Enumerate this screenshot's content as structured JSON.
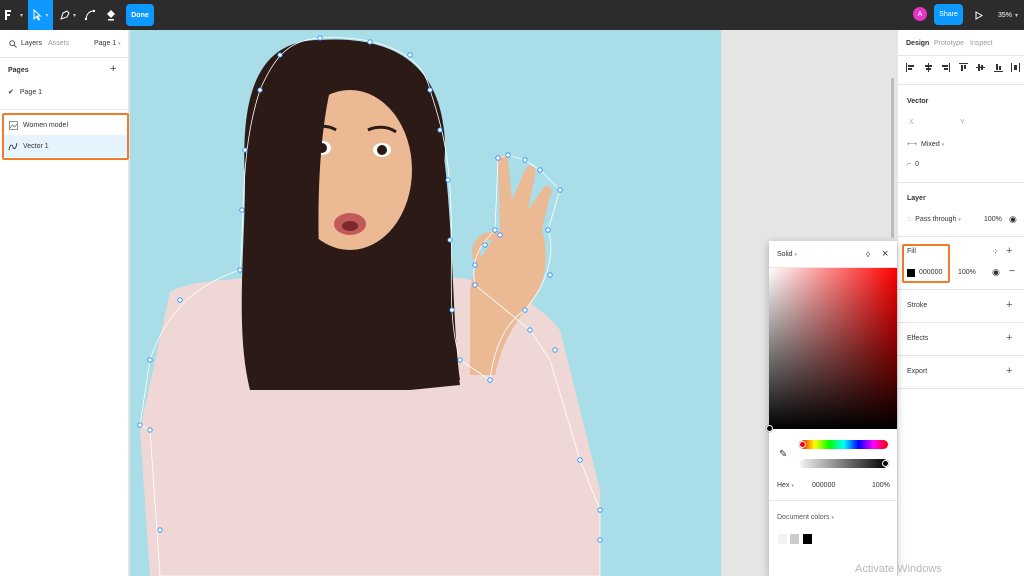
{
  "toolbar": {
    "done_label": "Done",
    "avatar_initial": "A",
    "share_label": "Share",
    "zoom": "35%"
  },
  "left_panel": {
    "tab_layers": "Layers",
    "tab_assets": "Assets",
    "page_selector": "Page 1",
    "pages_heading": "Pages",
    "pages": [
      {
        "label": "Page 1",
        "current": true
      }
    ],
    "layers": [
      {
        "label": "Women model",
        "icon": "image-icon",
        "selected": false
      },
      {
        "label": "Vector 1",
        "icon": "vector-path-icon",
        "selected": true
      }
    ]
  },
  "right_panel": {
    "tabs": [
      "Design",
      "Prototype",
      "Inspect"
    ],
    "active_tab": "Design",
    "vector_heading": "Vector",
    "x_label": "X",
    "y_label": "Y",
    "corner_value": "Mixed",
    "rotation_value": "0",
    "layer_heading": "Layer",
    "blend_mode": "Pass through",
    "layer_opacity": "100%",
    "fill_heading": "Fill",
    "fill_hex": "000000",
    "fill_opacity": "100%",
    "stroke_heading": "Stroke",
    "effects_heading": "Effects",
    "export_heading": "Export"
  },
  "color_picker": {
    "fill_type": "Solid",
    "format_label": "Hex",
    "hex_value": "000000",
    "opacity": "100%",
    "document_colors_label": "Document colors",
    "document_colors": [
      "#f2f2f2",
      "#cccccc",
      "#000000"
    ]
  },
  "system": {
    "watermark": "Activate Windows"
  },
  "colors": {
    "accent": "#0d99ff",
    "highlight": "#f07b2a",
    "canvas_photo_bg": "#a9dde7",
    "selection_bg": "#e5f4ff"
  }
}
